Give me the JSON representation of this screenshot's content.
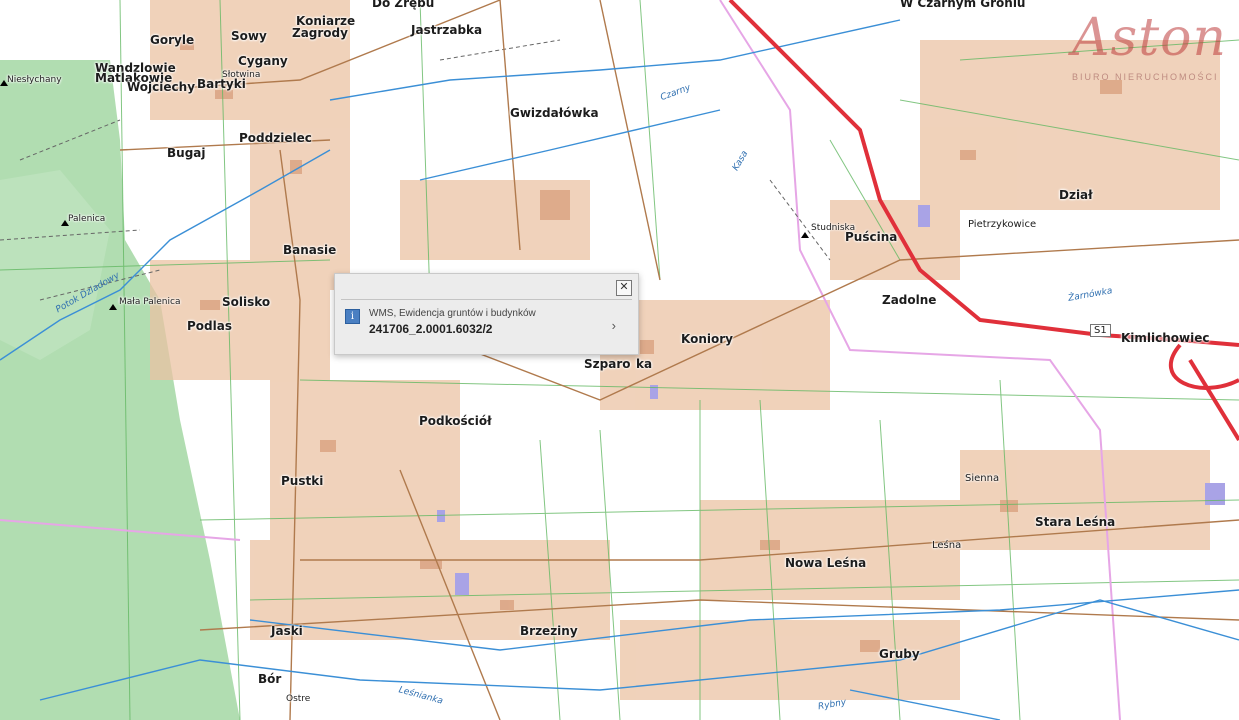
{
  "popup": {
    "layer_label": "WMS, Ewidencja gruntów i budynków",
    "parcel_id": "241706_2.0001.6032/2",
    "close_icon": "close-icon",
    "info_icon": "info-icon",
    "next_icon": "chevron-right-icon"
  },
  "logo": {
    "brand": "Aston",
    "tagline": "BIURO NIERUCHOMOŚCI"
  },
  "places": {
    "do_zrebu": "Do Zrębu",
    "koniarze_zagrody_1": "Koniarze",
    "koniarze_zagrody_2": "Zagrody",
    "jastrzabka": "Jastrzabka",
    "w_czarnym_gronie": "W Czarnym Groniu",
    "goryle": "Goryle",
    "sowy": "Sowy",
    "cygany": "Cygany",
    "wandzlowie": "Wandzlowie",
    "matlakowie": "Matlakowie",
    "slotwina": "Słotwina",
    "wojciechy": "Wojciechy",
    "bartyki": "Bartyki",
    "niestychany": "Niesłychany",
    "gwizdalowka": "Gwizdałówka",
    "poddzielec": "Poddzielec",
    "bugaj": "Bugaj",
    "palenica": "Palenica",
    "banasie": "Banasie",
    "studniska": "Studniska",
    "puscina": "Puścina",
    "pietrzykowice": "Pietrzykowice",
    "dzial": "Dział",
    "mala_palenica": "Mała Palenica",
    "solisko": "Solisko",
    "podlas": "Podlas",
    "zadolne": "Zadolne",
    "koniory": "Koniory",
    "kimlichowiec": "Kimlichowiec",
    "szparowka": "Szparo",
    "szparowka_end": "ka",
    "podkosciol": "Podkościół",
    "pustki": "Pustki",
    "sienna": "Sienna",
    "stara_lesna": "Stara Leśna",
    "lesna": "Leśna",
    "nowa_lesna": "Nowa Leśna",
    "jaski": "Jaski",
    "brzeziny": "Brzeziny",
    "gruby": "Gruby",
    "bor": "Bór",
    "ostre": "Ostre"
  },
  "water": {
    "czarny": "Czarny",
    "kasa": "Kasa",
    "potok_dziadowy": "Potok Dziadowy",
    "zarnowka": "Żarnówka",
    "lesnianka": "Leśnianka",
    "rybny": "Rybny"
  },
  "roads": {
    "s1": "S1"
  },
  "colors": {
    "built_up": "#e8b99a",
    "forest": "#a9d9a9",
    "water": "#3b8fd6",
    "boundary": "#e6a6e6",
    "expressway": "#e0303a",
    "parcel_lines": "#63b863"
  }
}
